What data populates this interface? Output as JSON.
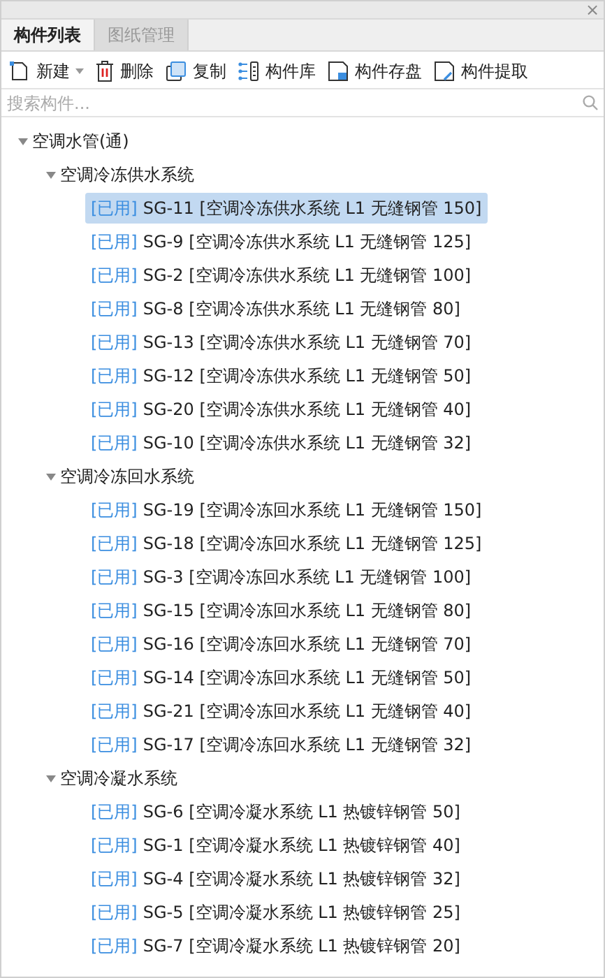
{
  "window": {
    "close": "×"
  },
  "tabs": [
    {
      "label": "构件列表",
      "selected": true
    },
    {
      "label": "图纸管理",
      "selected": false
    }
  ],
  "toolbar": [
    {
      "kind": "new",
      "label": "新建",
      "dropdown": true
    },
    {
      "kind": "delete",
      "label": "删除"
    },
    {
      "kind": "copy",
      "label": "复制"
    },
    {
      "kind": "library",
      "label": "构件库"
    },
    {
      "kind": "save",
      "label": "构件存盘"
    },
    {
      "kind": "extract",
      "label": "构件提取"
    }
  ],
  "search": {
    "placeholder": "搜索构件..."
  },
  "tree": [
    {
      "label": "空调水管(通)",
      "expanded": true,
      "children": [
        {
          "label": "空调冷冻供水系统",
          "expanded": true,
          "children": [
            {
              "tag": "[已用]",
              "label": "SG-11 [空调冷冻供水系统 L1 无缝钢管 150]",
              "selected": true
            },
            {
              "tag": "[已用]",
              "label": "SG-9 [空调冷冻供水系统 L1 无缝钢管 125]",
              "selected": false
            },
            {
              "tag": "[已用]",
              "label": "SG-2 [空调冷冻供水系统 L1 无缝钢管 100]",
              "selected": false
            },
            {
              "tag": "[已用]",
              "label": "SG-8 [空调冷冻供水系统 L1 无缝钢管 80]",
              "selected": false
            },
            {
              "tag": "[已用]",
              "label": "SG-13 [空调冷冻供水系统 L1 无缝钢管 70]",
              "selected": false
            },
            {
              "tag": "[已用]",
              "label": "SG-12 [空调冷冻供水系统 L1 无缝钢管 50]",
              "selected": false
            },
            {
              "tag": "[已用]",
              "label": "SG-20 [空调冷冻供水系统 L1 无缝钢管 40]",
              "selected": false
            },
            {
              "tag": "[已用]",
              "label": "SG-10 [空调冷冻供水系统 L1 无缝钢管 32]",
              "selected": false
            }
          ]
        },
        {
          "label": "空调冷冻回水系统",
          "expanded": true,
          "children": [
            {
              "tag": "[已用]",
              "label": "SG-19 [空调冷冻回水系统 L1 无缝钢管 150]",
              "selected": false
            },
            {
              "tag": "[已用]",
              "label": "SG-18 [空调冷冻回水系统 L1 无缝钢管 125]",
              "selected": false
            },
            {
              "tag": "[已用]",
              "label": "SG-3 [空调冷冻回水系统 L1 无缝钢管 100]",
              "selected": false
            },
            {
              "tag": "[已用]",
              "label": "SG-15 [空调冷冻回水系统 L1 无缝钢管 80]",
              "selected": false
            },
            {
              "tag": "[已用]",
              "label": "SG-16 [空调冷冻回水系统 L1 无缝钢管 70]",
              "selected": false
            },
            {
              "tag": "[已用]",
              "label": "SG-14 [空调冷冻回水系统 L1 无缝钢管 50]",
              "selected": false
            },
            {
              "tag": "[已用]",
              "label": "SG-21 [空调冷冻回水系统 L1 无缝钢管 40]",
              "selected": false
            },
            {
              "tag": "[已用]",
              "label": "SG-17 [空调冷冻回水系统 L1 无缝钢管 32]",
              "selected": false
            }
          ]
        },
        {
          "label": "空调冷凝水系统",
          "expanded": true,
          "children": [
            {
              "tag": "[已用]",
              "label": "SG-6 [空调冷凝水系统 L1 热镀锌钢管 50]",
              "selected": false
            },
            {
              "tag": "[已用]",
              "label": "SG-1 [空调冷凝水系统 L1 热镀锌钢管 40]",
              "selected": false
            },
            {
              "tag": "[已用]",
              "label": "SG-4 [空调冷凝水系统 L1 热镀锌钢管 32]",
              "selected": false
            },
            {
              "tag": "[已用]",
              "label": "SG-5 [空调冷凝水系统 L1 热镀锌钢管 25]",
              "selected": false
            },
            {
              "tag": "[已用]",
              "label": "SG-7 [空调冷凝水系统 L1 热镀锌钢管 20]",
              "selected": false
            }
          ]
        }
      ]
    }
  ]
}
